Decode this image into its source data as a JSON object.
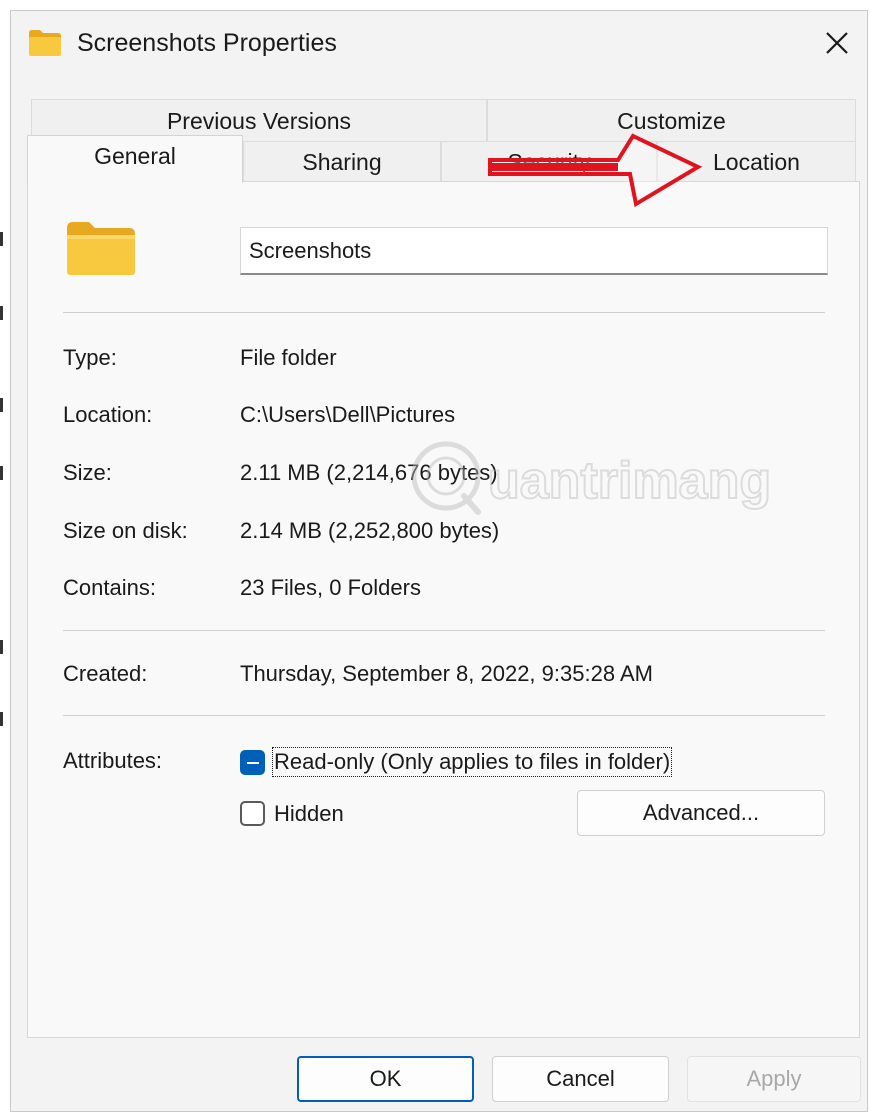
{
  "window": {
    "title": "Screenshots Properties"
  },
  "tabs": {
    "back_row": [
      "Previous Versions",
      "Customize"
    ],
    "front_row": [
      "General",
      "Sharing",
      "Security",
      "Location"
    ],
    "active": "General"
  },
  "general": {
    "folder_name": "Screenshots",
    "properties": [
      {
        "label": "Type:",
        "value": "File folder"
      },
      {
        "label": "Location:",
        "value": "C:\\Users\\Dell\\Pictures"
      },
      {
        "label": "Size:",
        "value": "2.11 MB (2,214,676 bytes)"
      },
      {
        "label": "Size on disk:",
        "value": "2.14 MB (2,252,800 bytes)"
      },
      {
        "label": "Contains:",
        "value": "23 Files, 0 Folders"
      }
    ],
    "created": {
      "label": "Created:",
      "value": "Thursday, September 8, 2022, 9:35:28 AM"
    },
    "attributes": {
      "label": "Attributes:",
      "readonly": {
        "label": "Read-only (Only applies to files in folder)",
        "state": "indeterminate"
      },
      "hidden": {
        "label": "Hidden",
        "state": "unchecked"
      },
      "advanced_label": "Advanced..."
    }
  },
  "footer": {
    "ok_label": "OK",
    "cancel_label": "Cancel",
    "apply_label": "Apply"
  },
  "watermark": {
    "text": "uantrimang"
  },
  "colors": {
    "accent": "#005fb8",
    "annotation_arrow": "#e0141e",
    "folder_yellow": "#f8c93e"
  }
}
